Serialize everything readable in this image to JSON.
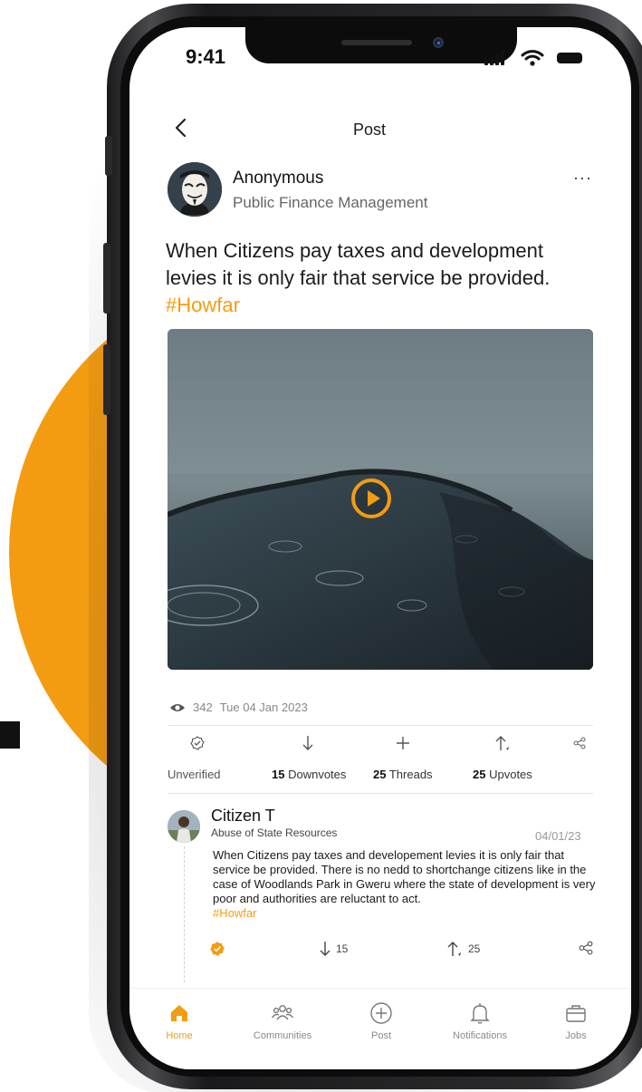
{
  "status_bar": {
    "time": "9:41"
  },
  "header": {
    "title": "Post"
  },
  "post": {
    "author": "Anonymous",
    "community": "Public Finance Management",
    "text": "When Citizens pay taxes and development levies it is only fair that service be provided.",
    "hashtag": "#Howfar",
    "views": "342",
    "date": "Tue 04 Jan 2023",
    "verification": "Unverified",
    "downvotes_count": "15",
    "downvotes_label": "Downvotes",
    "threads_count": "25",
    "threads_label": "Threads",
    "upvotes_count": "25",
    "upvotes_label": "Upvotes"
  },
  "comment": {
    "author": "Citizen T",
    "community": "Abuse of State Resources",
    "date": "04/01/23",
    "text": "When Citizens pay taxes and developement levies it is only fair that service be provided. There is no nedd to shortchange citizens like in the case of Woodlands Park in Gweru where the state of development is very poor and authorities are reluctant to act.",
    "hashtag": "#Howfar",
    "downvotes": "15",
    "upvotes": "25"
  },
  "tabs": [
    {
      "label": "Home",
      "icon": "home-icon"
    },
    {
      "label": "Communities",
      "icon": "communities-icon"
    },
    {
      "label": "Post",
      "icon": "add-circle-icon"
    },
    {
      "label": "Notifications",
      "icon": "bell-icon"
    },
    {
      "label": "Jobs",
      "icon": "briefcase-icon"
    }
  ],
  "colors": {
    "accent": "#f39c12",
    "text": "#1c1c1c",
    "muted": "#888888"
  }
}
